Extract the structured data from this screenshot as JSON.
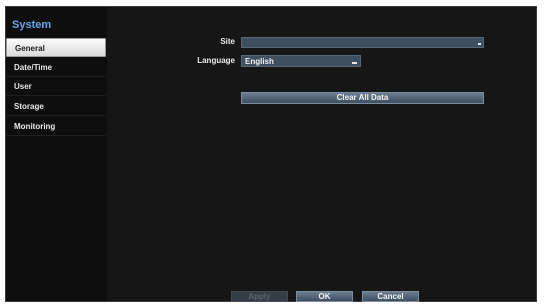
{
  "sidebar": {
    "title": "System",
    "items": [
      {
        "label": "General",
        "selected": true
      },
      {
        "label": "Date/Time",
        "selected": false
      },
      {
        "label": "User",
        "selected": false
      },
      {
        "label": "Storage",
        "selected": false
      },
      {
        "label": "Monitoring",
        "selected": false
      }
    ]
  },
  "general": {
    "site_label": "Site",
    "site_value": "",
    "language_label": "Language",
    "language_value": "English",
    "clear_button": "Clear All Data"
  },
  "footer": {
    "apply_label": "Apply",
    "apply_enabled": false,
    "ok_label": "OK",
    "cancel_label": "Cancel"
  },
  "colors": {
    "accent": "#6aa5e8",
    "field_background": "#3e4f60",
    "window_background": "#161616"
  }
}
